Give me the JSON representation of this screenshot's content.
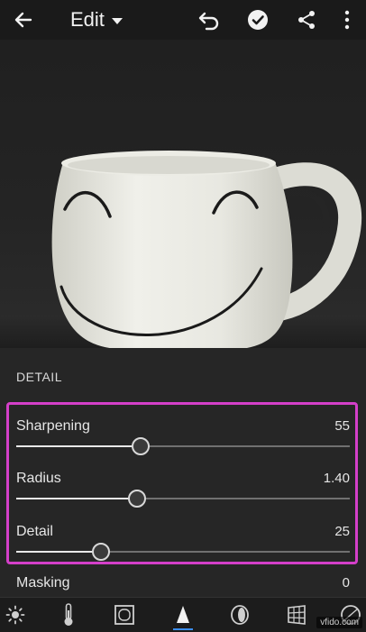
{
  "header": {
    "title": "Edit",
    "back_icon": "arrow-left-icon",
    "undo_icon": "undo-icon",
    "done_icon": "checkmark-circle-icon",
    "share_icon": "share-icon",
    "more_icon": "more-vertical-icon"
  },
  "panel": {
    "section_title": "DETAIL",
    "highlight_color": "#d43fc9",
    "sliders": [
      {
        "label": "Sharpening",
        "value": "55",
        "level": 0.37
      },
      {
        "label": "Radius",
        "value": "1.40",
        "level": 0.36
      },
      {
        "label": "Detail",
        "value": "25",
        "level": 0.25
      }
    ],
    "masking": {
      "label": "Masking",
      "value": "0"
    }
  },
  "toolbar": {
    "tools": [
      {
        "name": "light-icon"
      },
      {
        "name": "color-temperature-icon"
      },
      {
        "name": "vignette-icon"
      },
      {
        "name": "detail-icon",
        "active": true
      },
      {
        "name": "optics-icon"
      },
      {
        "name": "geometry-icon"
      },
      {
        "name": "effects-icon"
      }
    ],
    "active_color": "#3b8df0"
  },
  "watermark": "vfido.com"
}
